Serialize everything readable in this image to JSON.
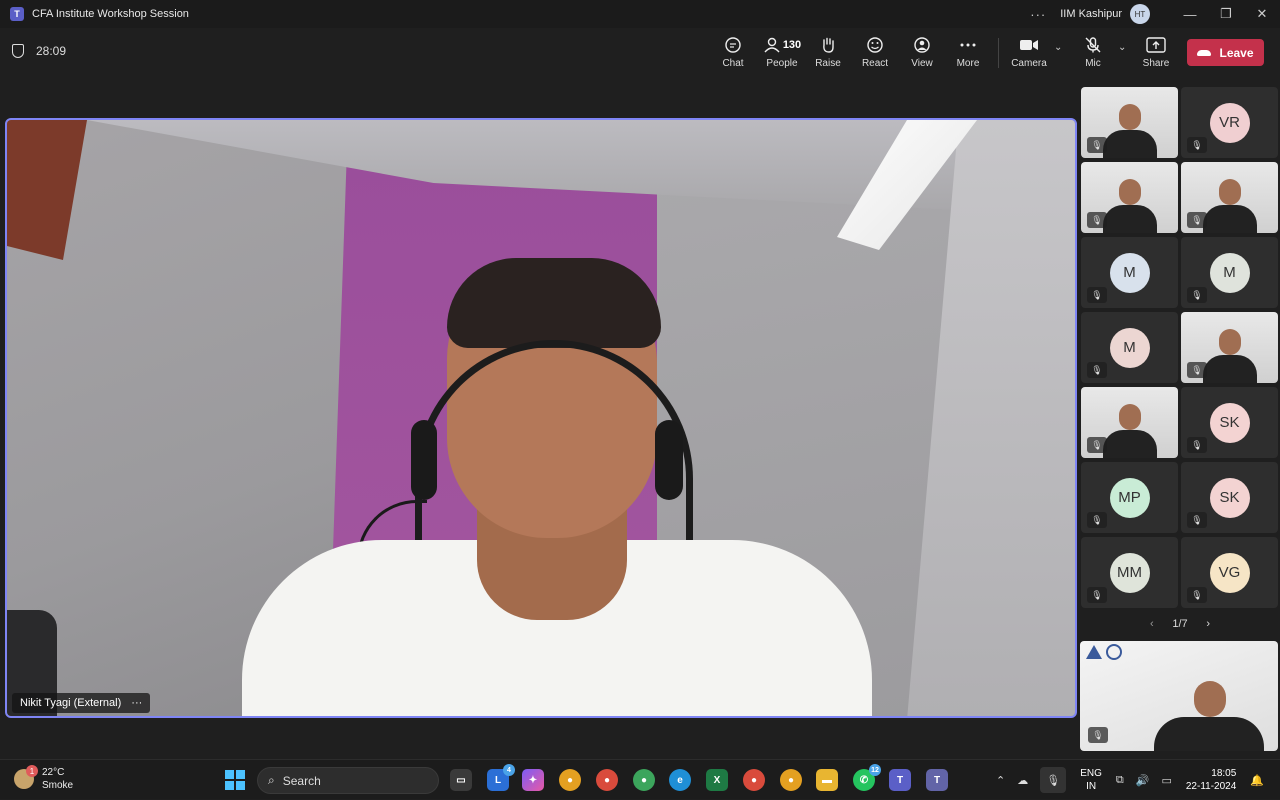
{
  "window": {
    "title": "CFA Institute Workshop Session",
    "more": "···",
    "org": "IIM Kashipur",
    "user_initials": "HT",
    "minimize": "—",
    "maximize": "❐",
    "close": "✕"
  },
  "toolbar": {
    "timer": "28:09",
    "chat": "Chat",
    "people": "People",
    "people_count": "130",
    "raise": "Raise",
    "react": "React",
    "view": "View",
    "more": "More",
    "camera": "Camera",
    "mic": "Mic",
    "share": "Share",
    "leave": "Leave"
  },
  "stage": {
    "speaker_name": "Nikit Tyagi (External)",
    "more": "···"
  },
  "participants": [
    {
      "type": "video",
      "initials": ""
    },
    {
      "type": "avatar",
      "initials": "VR",
      "color": "#f0cfd1"
    },
    {
      "type": "video",
      "initials": ""
    },
    {
      "type": "video",
      "initials": ""
    },
    {
      "type": "avatar",
      "initials": "M",
      "color": "#d8e1ec"
    },
    {
      "type": "avatar",
      "initials": "M",
      "color": "#dfe3dc"
    },
    {
      "type": "avatar",
      "initials": "M",
      "color": "#ecd6d2"
    },
    {
      "type": "video",
      "initials": ""
    },
    {
      "type": "video",
      "initials": ""
    },
    {
      "type": "avatar",
      "initials": "SK",
      "color": "#f3d3d2"
    },
    {
      "type": "avatar",
      "initials": "MP",
      "color": "#c9ecd6"
    },
    {
      "type": "avatar",
      "initials": "SK",
      "color": "#f3d3d2"
    },
    {
      "type": "avatar",
      "initials": "MM",
      "color": "#dfe4da"
    },
    {
      "type": "avatar",
      "initials": "VG",
      "color": "#f6e5c6"
    }
  ],
  "pager": {
    "label": "1/7",
    "prev": "‹",
    "next": "›"
  },
  "taskbar": {
    "weather_temp": "22°C",
    "weather_desc": "Smoke",
    "weather_badge": "1",
    "search_placeholder": "Search",
    "lang_top": "ENG",
    "lang_bottom": "IN",
    "time": "18:05",
    "date": "22-11-2024",
    "badge_l": "4",
    "badge_whatsapp": "12"
  }
}
